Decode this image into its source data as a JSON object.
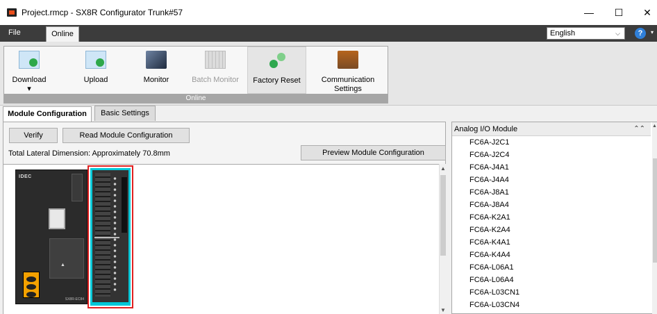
{
  "window": {
    "title": "Project.rmcp - SX8R Configurator Trunk#57",
    "minimize": "—",
    "maximize": "☐",
    "close": "✕"
  },
  "menu": {
    "file": "File",
    "online": "Online",
    "language": "English",
    "language_chevron": "⌵",
    "help": "?",
    "help_caret": "▾"
  },
  "ribbon": {
    "group_label": "Online",
    "buttons": [
      {
        "label": "Download",
        "sub": "▾",
        "icon": "download-icon"
      },
      {
        "label": "Upload",
        "icon": "upload-icon"
      },
      {
        "label": "Monitor",
        "icon": "monitor-icon"
      },
      {
        "label": "Batch Monitor",
        "icon": "batch-monitor-icon",
        "disabled": true
      },
      {
        "label": "Factory Reset",
        "icon": "factory-reset-icon"
      },
      {
        "label": "Communication",
        "label2": "Settings",
        "icon": "communication-settings-icon"
      }
    ]
  },
  "tabs": {
    "module_configuration": "Module Configuration",
    "basic_settings": "Basic Settings"
  },
  "module_config": {
    "verify": "Verify",
    "read": "Read Module Configuration",
    "total_lateral": "Total Lateral Dimension: Approximately 70.8mm",
    "preview": "Preview Module Configuration"
  },
  "cpu_module": {
    "logo": "IDEC",
    "model": "SX8R-EC84"
  },
  "list_panel": {
    "header": "Analog I/O Module",
    "collapse_glyph": "⌃⌃",
    "items": [
      "FC6A-J2C1",
      "FC6A-J2C4",
      "FC6A-J4A1",
      "FC6A-J4A4",
      "FC6A-J8A1",
      "FC6A-J8A4",
      "FC6A-K2A1",
      "FC6A-K2A4",
      "FC6A-K4A1",
      "FC6A-K4A4",
      "FC6A-L06A1",
      "FC6A-L06A4",
      "FC6A-L03CN1",
      "FC6A-L03CN4"
    ]
  },
  "colors": {
    "menubar": "#3c3c3c",
    "selection_border": "#e02020",
    "selection_fill": "#00c8d8"
  }
}
